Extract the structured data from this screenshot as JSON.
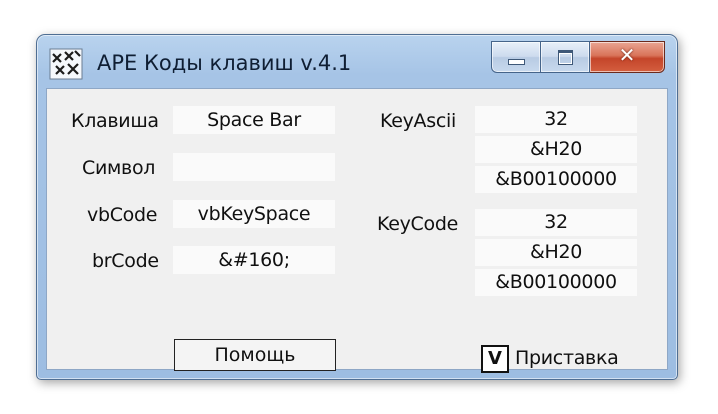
{
  "window": {
    "title": "АРЕ Коды клавиш v.4.1",
    "icon": "keyboard-app-icon"
  },
  "caption": {
    "minimize_icon": "minimize-icon",
    "maximize_icon": "maximize-icon",
    "close_icon": "close-icon",
    "close_glyph": "✕"
  },
  "left": {
    "key_label": "Клавиша",
    "key_value": "Space Bar",
    "symbol_label": "Символ",
    "symbol_value": "",
    "vbcode_label": "vbCode",
    "vbcode_value": "vbKeySpace",
    "brcode_label": "brCode",
    "brcode_value": "&#160;"
  },
  "right": {
    "keyascii_label": "KeyAscii",
    "keyascii_dec": "32",
    "keyascii_hex": "&H20",
    "keyascii_bin": "&B00100000",
    "keycode_label": "KeyCode",
    "keycode_dec": "32",
    "keycode_hex": "&H20",
    "keycode_bin": "&B00100000"
  },
  "help_button": "Помощь",
  "prefix_checkbox": {
    "mark": "V",
    "label": "Приставка",
    "checked": true
  },
  "colors": {
    "frame": "#a6c4e6",
    "close": "#c4452a",
    "client": "#f0f0f0"
  }
}
